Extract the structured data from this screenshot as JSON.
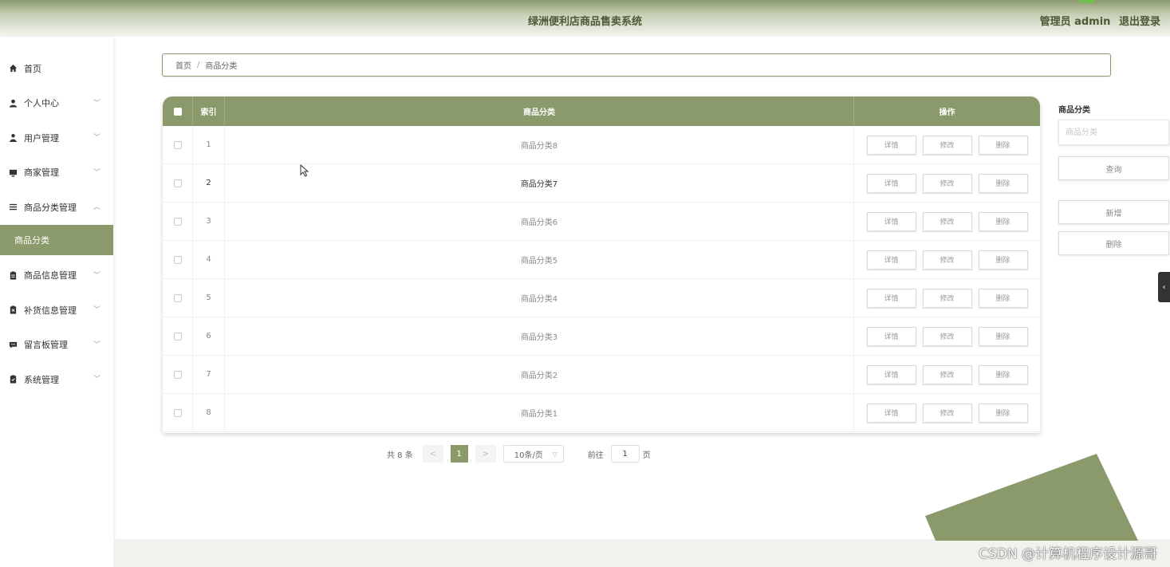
{
  "header": {
    "title": "绿洲便利店商品售卖系统",
    "user_label": "管理员 admin",
    "logout_label": "退出登录"
  },
  "sidebar": {
    "items": [
      {
        "label": "首页",
        "icon": "home-icon",
        "chevron": ""
      },
      {
        "label": "个人中心",
        "icon": "person-icon",
        "chevron": "﹀"
      },
      {
        "label": "用户管理",
        "icon": "user-icon",
        "chevron": "﹀"
      },
      {
        "label": "商家管理",
        "icon": "monitor-icon",
        "chevron": "﹀"
      },
      {
        "label": "商品分类管理",
        "icon": "list-icon",
        "chevron": "︿"
      }
    ],
    "active_sub": "商品分类",
    "items_after": [
      {
        "label": "商品信息管理",
        "icon": "clipboard-icon",
        "chevron": "﹀"
      },
      {
        "label": "补货信息管理",
        "icon": "clipboard-x-icon",
        "chevron": "﹀"
      },
      {
        "label": "留言板管理",
        "icon": "comment-icon",
        "chevron": "﹀"
      },
      {
        "label": "系统管理",
        "icon": "clipboard-check-icon",
        "chevron": "﹀"
      }
    ]
  },
  "breadcrumb": {
    "home": "首页",
    "separator": "/",
    "current": "商品分类"
  },
  "table": {
    "headers": {
      "index": "索引",
      "name": "商品分类",
      "actions": "操作"
    },
    "rows": [
      {
        "index": "1",
        "name": "商品分类8"
      },
      {
        "index": "2",
        "name": "商品分类7"
      },
      {
        "index": "3",
        "name": "商品分类6"
      },
      {
        "index": "4",
        "name": "商品分类5"
      },
      {
        "index": "5",
        "name": "商品分类4"
      },
      {
        "index": "6",
        "name": "商品分类3"
      },
      {
        "index": "7",
        "name": "商品分类2"
      },
      {
        "index": "8",
        "name": "商品分类1"
      }
    ],
    "actions": {
      "detail": "详情",
      "edit": "修改",
      "delete": "删除"
    }
  },
  "pagination": {
    "total": "共 8 条",
    "prev": "<",
    "page": "1",
    "next": ">",
    "page_size": "10条/页",
    "goto_prefix": "前往",
    "goto_value": "1",
    "goto_suffix": "页"
  },
  "search_panel": {
    "label": "商品分类",
    "placeholder": "商品分类",
    "query_button": "查询",
    "add_button": "新增",
    "delete_button": "删除"
  },
  "watermark": "CSDN @计算机程序设计源哥",
  "colors": {
    "accent": "#8a9a6b"
  }
}
